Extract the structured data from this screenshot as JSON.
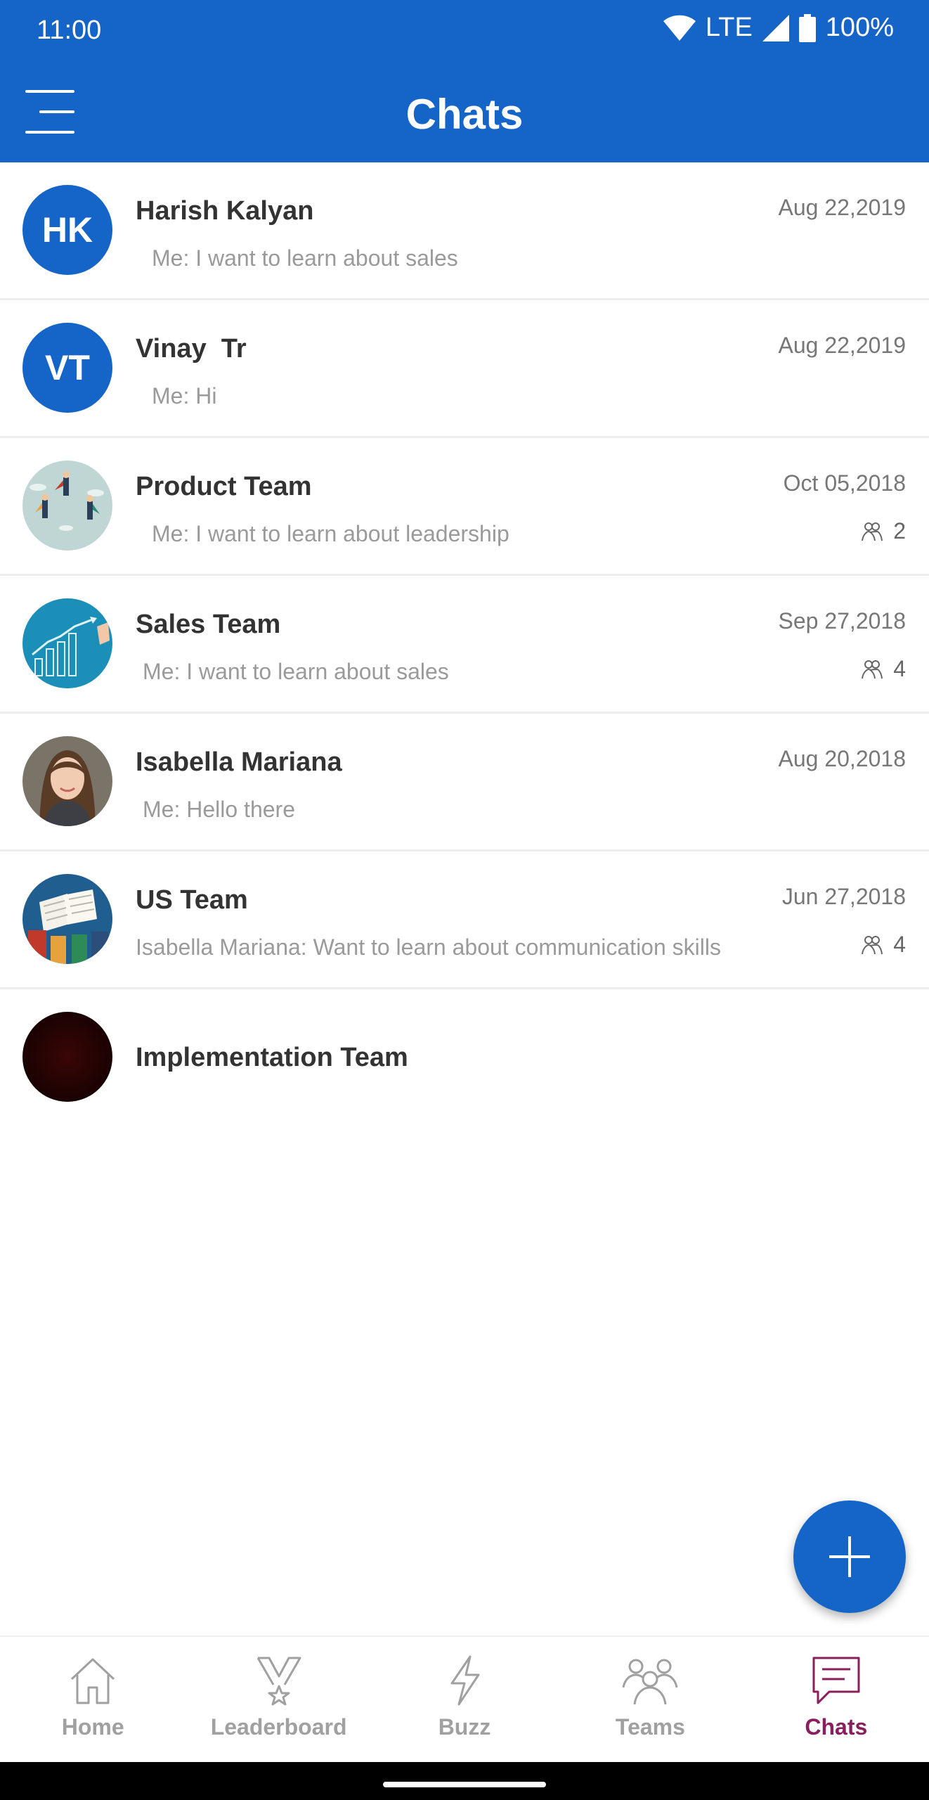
{
  "status": {
    "time": "11:00",
    "network": "LTE",
    "battery": "100%"
  },
  "header": {
    "title": "Chats"
  },
  "chats": [
    {
      "initials": "HK",
      "name": "Harish Kalyan",
      "date": "Aug 22,2019",
      "message": "Me: I want to learn about sales"
    },
    {
      "initials": "VT",
      "name": "Vinay  Tr",
      "date": "Aug 22,2019",
      "message": "Me: Hi"
    },
    {
      "name": "Product Team",
      "date": "Oct 05,2018",
      "message": "Me: I want to learn about leadership",
      "members": "2"
    },
    {
      "name": "Sales Team",
      "date": "Sep 27,2018",
      "message": "Me: I want to learn about sales",
      "members": "4"
    },
    {
      "name": "Isabella Mariana",
      "date": "Aug 20,2018",
      "message": "Me: Hello there"
    },
    {
      "name": "US Team",
      "date": "Jun 27,2018",
      "message": "Isabella Mariana: Want to learn about communication skills",
      "members": "4"
    },
    {
      "name": "Implementation Team"
    }
  ],
  "nav": {
    "home": "Home",
    "leaderboard": "Leaderboard",
    "buzz": "Buzz",
    "teams": "Teams",
    "chats": "Chats"
  },
  "colors": {
    "primary": "#1565c8",
    "active_nav": "#8a1f5c",
    "inactive_nav": "#a0a0a0"
  }
}
